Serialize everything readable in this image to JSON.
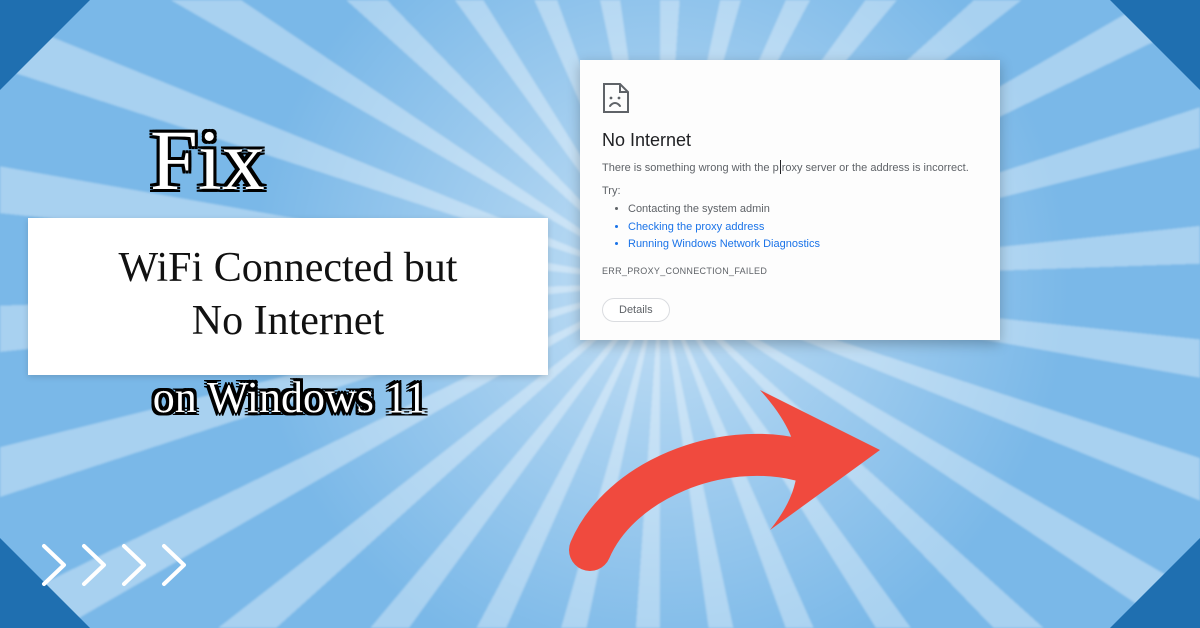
{
  "hero": {
    "fix": "Fix",
    "card_line1": "WiFi Connected but",
    "card_line2": "No Internet",
    "subline": "on Windows 11"
  },
  "error_panel": {
    "title": "No Internet",
    "desc_before": "There is something wrong with the p",
    "desc_after": "roxy server or the address is incorrect.",
    "try_label": "Try:",
    "items": [
      {
        "text": "Contacting the system admin",
        "link": false
      },
      {
        "text": "Checking the proxy address",
        "link": true
      },
      {
        "text": "Running Windows Network Diagnostics",
        "link": true
      }
    ],
    "error_code": "ERR_PROXY_CONNECTION_FAILED",
    "details_button": "Details"
  },
  "colors": {
    "accent_arrow": "#f04a3e",
    "bg": "#7ab8e8",
    "corner": "#1f6fb0"
  }
}
